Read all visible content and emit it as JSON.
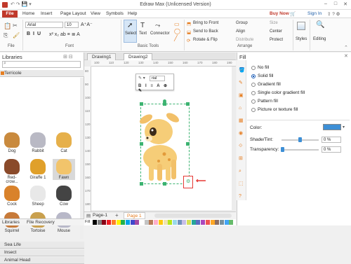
{
  "window": {
    "title": "Edraw Max (Unlicensed Version)"
  },
  "menu": {
    "file": "File",
    "items": [
      "Home",
      "Insert",
      "Page Layout",
      "View",
      "Symbols",
      "Help"
    ],
    "buy_now": "Buy Now",
    "sign_in": "Sign In"
  },
  "ribbon": {
    "font": "Arial",
    "size": "10",
    "groups": {
      "file": "File",
      "font": "Font",
      "basic_tools": "Basic Tools",
      "arrange": "Arrange"
    },
    "tools": {
      "select": "Select",
      "text": "Text",
      "connector": "Connector"
    },
    "arrange": {
      "bring_front": "Bring to Front",
      "send_back": "Send to Back",
      "rotate": "Rotate & Flip",
      "group": "Group",
      "align": "Align",
      "distribute": "Distribute",
      "size": "Size",
      "center": "Center",
      "protect": "Protect"
    },
    "styles": "Styles",
    "editing": "Editing"
  },
  "libraries": {
    "title": "Libraries",
    "category": "Terricole",
    "shapes": [
      {
        "label": "Dog",
        "color": "#c98a3e"
      },
      {
        "label": "Rabbit",
        "color": "#b9b9c4"
      },
      {
        "label": "Cat",
        "color": "#e6b04b"
      },
      {
        "label": "Red-crow...",
        "color": "#8a4a2a"
      },
      {
        "label": "Giraffe 1",
        "color": "#e0a02a"
      },
      {
        "label": "Fawn",
        "color": "#f2c46b"
      },
      {
        "label": "Cock",
        "color": "#d9822b"
      },
      {
        "label": "Sheep",
        "color": "#e8e8e8"
      },
      {
        "label": "Cow",
        "color": "#444444"
      },
      {
        "label": "Squirrel",
        "color": "#c77a3a"
      },
      {
        "label": "Tortoise",
        "color": "#c9a04e"
      },
      {
        "label": "Mouse",
        "color": "#b8b8c8"
      }
    ],
    "collapsed": [
      "Sea Life",
      "Insect",
      "Animal Head"
    ],
    "bottom_tabs": [
      "Libraries",
      "File Recovery"
    ]
  },
  "canvas": {
    "tabs": [
      "Drawing1",
      "Drawing2"
    ],
    "ruler_h": [
      "100",
      "110",
      "120",
      "130",
      "140",
      "150",
      "160",
      "170",
      "180",
      "190"
    ],
    "ruler_v": [
      "80",
      "90",
      "100",
      "110",
      "120",
      "130",
      "140",
      "150",
      "160",
      "170",
      "180"
    ],
    "text_toolbar_font": "rial",
    "page_tabs": [
      "Page-1",
      "Page 1"
    ]
  },
  "fill_panel": {
    "title": "Fill",
    "options": [
      "No fill",
      "Solid fill",
      "Gradient fill",
      "Single color gradient fill",
      "Pattern fill",
      "Picture or texture fill"
    ],
    "selected": "Solid fill",
    "color_label": "Color:",
    "color": "#3d8fd6",
    "shade_label": "Shade/Tint:",
    "shade_value": "0 %",
    "transparency_label": "Transparency:",
    "transparency_value": "0 %"
  },
  "palette": [
    "#000000",
    "#7f7f7f",
    "#880015",
    "#ed1c24",
    "#ff7f27",
    "#fff200",
    "#22b14c",
    "#00a2e8",
    "#3f48cc",
    "#a349a4",
    "#ffffff",
    "#c3c3c3",
    "#b97a57",
    "#ffaec9",
    "#ffc90e",
    "#efe4b0",
    "#b5e61d",
    "#99d9ea",
    "#7092be",
    "#c8bfe7",
    "#d4e157",
    "#26a69a",
    "#5c6bc0",
    "#ab47bc",
    "#ef5350",
    "#ffa726",
    "#8d6e63",
    "#78909c",
    "#42a5f5",
    "#66bb6a"
  ]
}
